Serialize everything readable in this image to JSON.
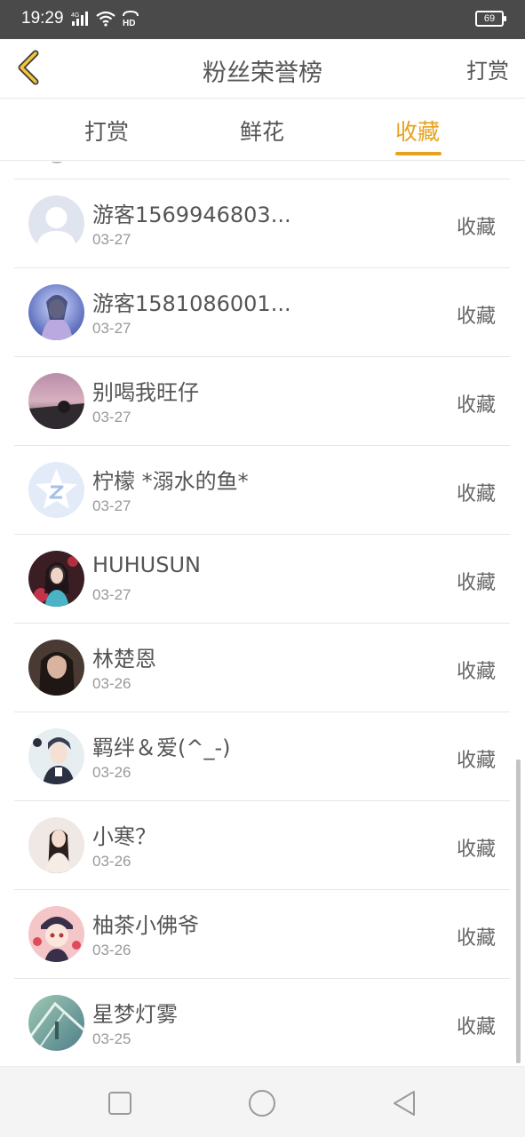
{
  "status_bar": {
    "time": "19:29",
    "network": "4G",
    "hd": "HD",
    "battery": "69"
  },
  "header": {
    "title": "粉丝荣誉榜",
    "action": "打赏"
  },
  "tabs": [
    {
      "label": "打赏",
      "active": false
    },
    {
      "label": "鲜花",
      "active": false
    },
    {
      "label": "收藏",
      "active": true
    }
  ],
  "accent_color": "#e8a21e",
  "list": [
    {
      "name": "游客1569946803...",
      "date": "03-27",
      "type": "收藏"
    },
    {
      "name": "游客1581086001...",
      "date": "03-27",
      "type": "收藏"
    },
    {
      "name": "别喝我旺仔",
      "date": "03-27",
      "type": "收藏"
    },
    {
      "name": "柠檬 *溺水的鱼*",
      "date": "03-27",
      "type": "收藏"
    },
    {
      "name": "HUHUSUN",
      "date": "03-27",
      "type": "收藏"
    },
    {
      "name": "林楚恩",
      "date": "03-26",
      "type": "收藏"
    },
    {
      "name": "羁绊＆爱(^_-)",
      "date": "03-26",
      "type": "收藏"
    },
    {
      "name": "小寒？",
      "date": "03-26",
      "type": "收藏"
    },
    {
      "name": "柚茶小佛爷",
      "date": "03-26",
      "type": "收藏"
    },
    {
      "name": "星梦灯雾",
      "date": "03-25",
      "type": "收藏"
    }
  ]
}
